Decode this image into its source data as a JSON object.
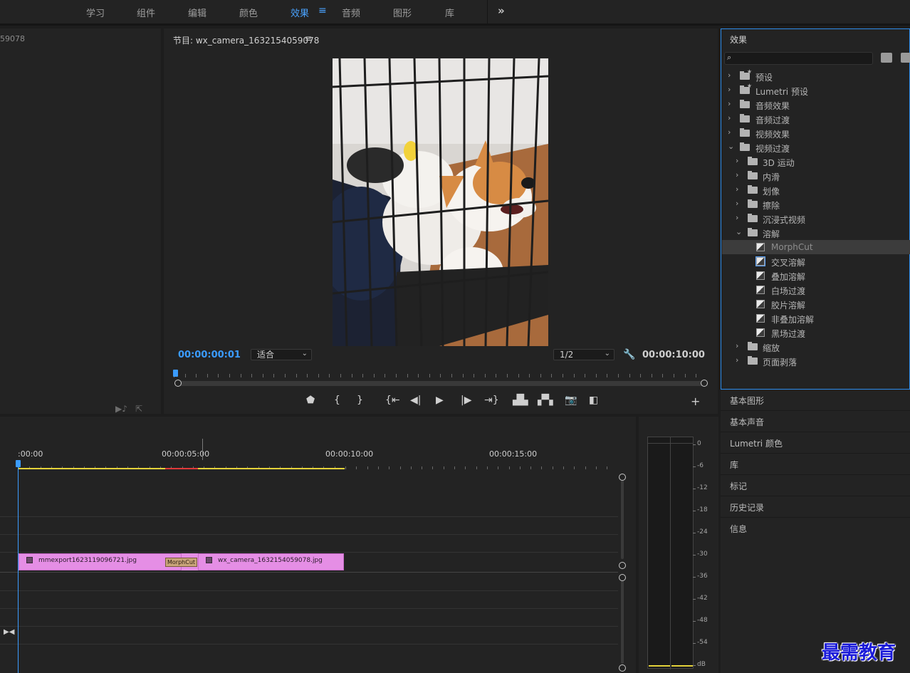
{
  "workspace_tabs": [
    {
      "label": "学习"
    },
    {
      "label": "组件"
    },
    {
      "label": "编辑"
    },
    {
      "label": "颜色"
    },
    {
      "label": "效果",
      "active": true
    },
    {
      "label": "音频"
    },
    {
      "label": "图形"
    },
    {
      "label": "库"
    }
  ],
  "workspace_more": "»",
  "source": {
    "title": "59078"
  },
  "program": {
    "title": "节目: wx_camera_1632154059078",
    "menu": "≡",
    "current_timecode": "00:00:00:01",
    "total_timecode": "00:00:10:00",
    "zoom_select": "适合",
    "resolution_select": "1/2"
  },
  "effects": {
    "title": "效果",
    "search_value": "",
    "tree": [
      {
        "label": "预设",
        "level": 0,
        "kind": "star-folder",
        "expanded": false
      },
      {
        "label": "Lumetri 预设",
        "level": 0,
        "kind": "star-folder",
        "expanded": false
      },
      {
        "label": "音频效果",
        "level": 0,
        "kind": "folder",
        "expanded": false
      },
      {
        "label": "音频过渡",
        "level": 0,
        "kind": "folder",
        "expanded": false
      },
      {
        "label": "视频效果",
        "level": 0,
        "kind": "folder",
        "expanded": false
      },
      {
        "label": "视频过渡",
        "level": 0,
        "kind": "folder",
        "expanded": true
      },
      {
        "label": "3D 运动",
        "level": 1,
        "kind": "folder",
        "expanded": false
      },
      {
        "label": "内滑",
        "level": 1,
        "kind": "folder",
        "expanded": false
      },
      {
        "label": "划像",
        "level": 1,
        "kind": "folder",
        "expanded": false
      },
      {
        "label": "擦除",
        "level": 1,
        "kind": "folder",
        "expanded": false
      },
      {
        "label": "沉浸式视频",
        "level": 1,
        "kind": "folder",
        "expanded": false
      },
      {
        "label": "溶解",
        "level": 1,
        "kind": "folder",
        "expanded": true
      },
      {
        "label": "MorphCut",
        "level": 2,
        "kind": "transition",
        "selected": true
      },
      {
        "label": "交叉溶解",
        "level": 2,
        "kind": "transition",
        "focused": true
      },
      {
        "label": "叠加溶解",
        "level": 2,
        "kind": "transition"
      },
      {
        "label": "白场过渡",
        "level": 2,
        "kind": "transition"
      },
      {
        "label": "胶片溶解",
        "level": 2,
        "kind": "transition"
      },
      {
        "label": "非叠加溶解",
        "level": 2,
        "kind": "transition"
      },
      {
        "label": "黑场过渡",
        "level": 2,
        "kind": "transition"
      },
      {
        "label": "缩放",
        "level": 1,
        "kind": "folder",
        "expanded": false
      },
      {
        "label": "页面剥落",
        "level": 1,
        "kind": "folder",
        "expanded": false
      }
    ]
  },
  "side_panels": [
    {
      "label": "基本图形"
    },
    {
      "label": "基本声音"
    },
    {
      "label": "Lumetri 颜色"
    },
    {
      "label": "库"
    },
    {
      "label": "标记"
    },
    {
      "label": "历史记录"
    },
    {
      "label": "信息"
    }
  ],
  "timeline": {
    "timecodes": [
      ":00:00",
      "00:00:05:00",
      "00:00:10:00",
      "00:00:15:00"
    ],
    "clip_a": "mmexport1623119096721.jpg",
    "clip_b": "wx_camera_1632154059078.jpg",
    "transition": "MorphCut"
  },
  "meter": {
    "db_labels": [
      "0",
      "-6",
      "-12",
      "-18",
      "-24",
      "-30",
      "-36",
      "-42",
      "-48",
      "-54",
      "dB"
    ]
  },
  "watermark": "最需教育",
  "colors": {
    "accent": "#3b9cff",
    "clip": "#e58ee5",
    "render_bar": "#e5d33a"
  }
}
